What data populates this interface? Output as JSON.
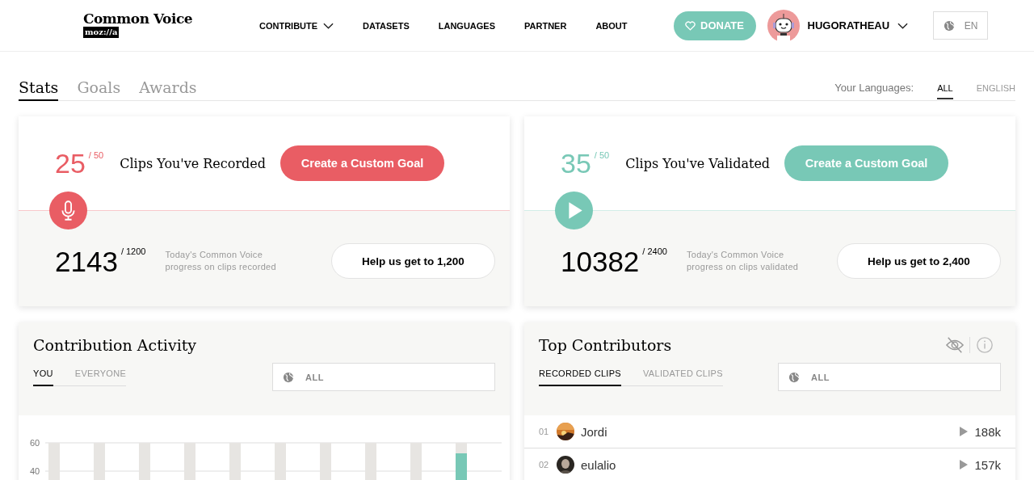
{
  "header": {
    "logo": {
      "title": "Common Voice",
      "badge": "moz://a"
    },
    "nav": [
      {
        "label": "CONTRIBUTE",
        "dropdown": true
      },
      {
        "label": "DATASETS",
        "dropdown": false
      },
      {
        "label": "LANGUAGES",
        "dropdown": false
      },
      {
        "label": "PARTNER",
        "dropdown": false
      },
      {
        "label": "ABOUT",
        "dropdown": false
      }
    ],
    "donate": "DONATE",
    "user": {
      "name": "HUGORATHEAU"
    },
    "language": "EN"
  },
  "tabs": [
    {
      "label": "Stats",
      "selected": true
    },
    {
      "label": "Goals",
      "selected": false
    },
    {
      "label": "Awards",
      "selected": false
    }
  ],
  "languages": {
    "label": "Your Languages:",
    "options": [
      {
        "label": "ALL",
        "selected": true
      },
      {
        "label": "ENGLISH",
        "selected": false
      }
    ]
  },
  "goals": [
    {
      "kind": "record",
      "color": "#e95d64",
      "count": "25",
      "target": "/ 50",
      "label": "Clips You've Recorded",
      "button": "Create a Custom Goal",
      "total": "2143",
      "total_target": "/ 1200",
      "caption": "Today's Common Voice progress on clips recorded",
      "help": "Help us get to 1,200"
    },
    {
      "kind": "validate",
      "color": "#78c8b6",
      "count": "35",
      "target": "/ 50",
      "label": "Clips You've Validated",
      "button": "Create a Custom Goal",
      "total": "10382",
      "total_target": "/ 2400",
      "caption": "Today's Common Voice progress on clips validated",
      "help": "Help us get to 2,400"
    }
  ],
  "activity": {
    "title": "Contribution Activity",
    "tabs": [
      {
        "label": "YOU",
        "selected": true
      },
      {
        "label": "EVERYONE",
        "selected": false
      }
    ],
    "filter": "ALL",
    "chart_axis_labels": [
      "60",
      "40"
    ]
  },
  "contributors": {
    "title": "Top Contributors",
    "tabs": [
      {
        "label": "RECORDED CLIPS",
        "selected": true
      },
      {
        "label": "VALIDATED CLIPS",
        "selected": false
      }
    ],
    "filter": "ALL",
    "rows": [
      {
        "rank": "01",
        "name": "Jordi",
        "count": "188k"
      },
      {
        "rank": "02",
        "name": "eulalio",
        "count": "157k"
      }
    ]
  }
}
